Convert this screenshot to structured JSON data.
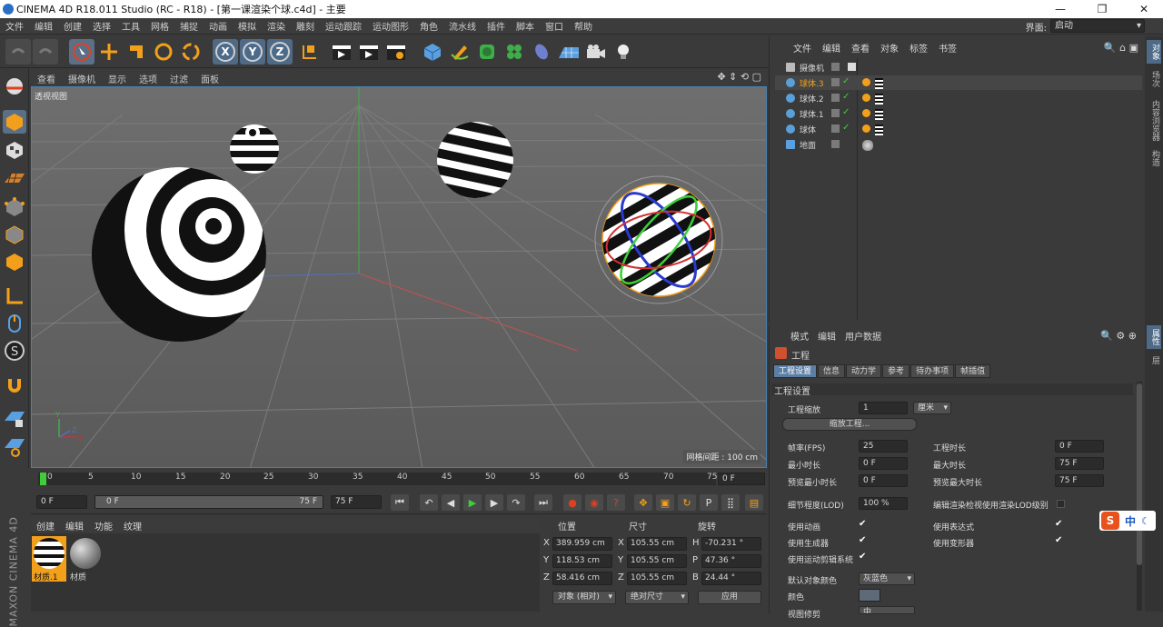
{
  "window": {
    "title": "CINEMA 4D R18.011 Studio (RC - R18) - [第一课渲染个球.c4d] - 主要",
    "minimize": "—",
    "maximize": "❐",
    "close": "✕"
  },
  "menubar": {
    "items": [
      "文件",
      "编辑",
      "创建",
      "选择",
      "工具",
      "网格",
      "捕捉",
      "动画",
      "模拟",
      "渲染",
      "雕刻",
      "运动跟踪",
      "运动图形",
      "角色",
      "流水线",
      "插件",
      "脚本",
      "窗口",
      "帮助"
    ],
    "layout_label": "界面:",
    "layout_value": "启动"
  },
  "toolbar": {
    "axis_x": "X",
    "axis_y": "Y",
    "axis_z": "Z"
  },
  "viewport": {
    "menu": [
      "查看",
      "摄像机",
      "显示",
      "选项",
      "过滤",
      "面板"
    ],
    "label": "透视视图",
    "grid_distance": "网格间距 : 100 cm"
  },
  "timeline": {
    "ticks": [
      "0",
      "5",
      "10",
      "15",
      "20",
      "25",
      "30",
      "35",
      "40",
      "45",
      "50",
      "55",
      "60",
      "65",
      "70",
      "75"
    ],
    "end_field": "0 F",
    "current_frame": 0
  },
  "transport": {
    "start_field": "0 F",
    "range_start": "0 F",
    "range_end": "75 F",
    "end_field": "75 F"
  },
  "materials": {
    "menu": [
      "创建",
      "编辑",
      "功能",
      "纹理"
    ],
    "items": [
      {
        "name": "材质.1",
        "selected": true
      },
      {
        "name": "材质",
        "selected": false
      }
    ]
  },
  "coordinates": {
    "headers": {
      "position": "位置",
      "size": "尺寸",
      "rotation": "旋转"
    },
    "rows": [
      {
        "axis": "X",
        "pos": "389.959 cm",
        "size_axis": "X",
        "size": "105.55 cm",
        "rot_axis": "H",
        "rot": "-70.231 °"
      },
      {
        "axis": "Y",
        "pos": "118.53 cm",
        "size_axis": "Y",
        "size": "105.55 cm",
        "rot_axis": "P",
        "rot": "47.36 °"
      },
      {
        "axis": "Z",
        "pos": "58.416 cm",
        "size_axis": "Z",
        "size": "105.55 cm",
        "rot_axis": "B",
        "rot": "24.44 °"
      }
    ],
    "mode_object": "对象 (相对)",
    "mode_size": "绝对尺寸",
    "apply": "应用"
  },
  "logo": {
    "text": "MAXON CINEMA 4D"
  },
  "objects": {
    "menu": [
      "文件",
      "编辑",
      "查看",
      "对象",
      "标签",
      "书签"
    ],
    "items": [
      {
        "name": "摄像机",
        "highlight": false
      },
      {
        "name": "球体.3",
        "highlight": true
      },
      {
        "name": "球体.2",
        "highlight": false
      },
      {
        "name": "球体.1",
        "highlight": false
      },
      {
        "name": "球体",
        "highlight": false
      },
      {
        "name": "地面",
        "highlight": false
      }
    ]
  },
  "right_tabs": [
    "对象",
    "场次",
    "内容浏览器",
    "构造",
    "属性",
    "层"
  ],
  "attributes": {
    "menu": [
      "模式",
      "编辑",
      "用户数据"
    ],
    "title": "工程",
    "tabs": [
      "工程设置",
      "信息",
      "动力学",
      "参考",
      "待办事项",
      "帧插值"
    ],
    "section": "工程设置",
    "project_scale_label": "工程缩放",
    "project_scale_value": "1",
    "project_scale_unit": "厘米",
    "scale_button": "缩放工程...",
    "fps_label": "帧率(FPS)",
    "fps_value": "25",
    "project_length_label": "工程时长",
    "project_length_value": "0 F",
    "min_time_label": "最小时长",
    "min_time_value": "0 F",
    "max_time_label": "最大时长",
    "max_time_value": "75 F",
    "preview_min_label": "预览最小时长",
    "preview_min_value": "0 F",
    "preview_max_label": "预览最大时长",
    "preview_max_value": "75 F",
    "lod_label": "细节程度(LOD)",
    "lod_value": "100 %",
    "lod_render_label": "编辑渲染检视使用渲染LOD级别",
    "use_anim_label": "使用动画",
    "use_expr_label": "使用表达式",
    "use_gen_label": "使用生成器",
    "use_deform_label": "使用变形器",
    "use_motion_label": "使用运动剪辑系统",
    "default_color_label": "默认对象颜色",
    "default_color_value": "灰蓝色",
    "color_label": "颜色",
    "view_clip_label": "视图修剪",
    "view_clip_value": "中"
  },
  "ime": {
    "logo": "S",
    "text": "中"
  }
}
